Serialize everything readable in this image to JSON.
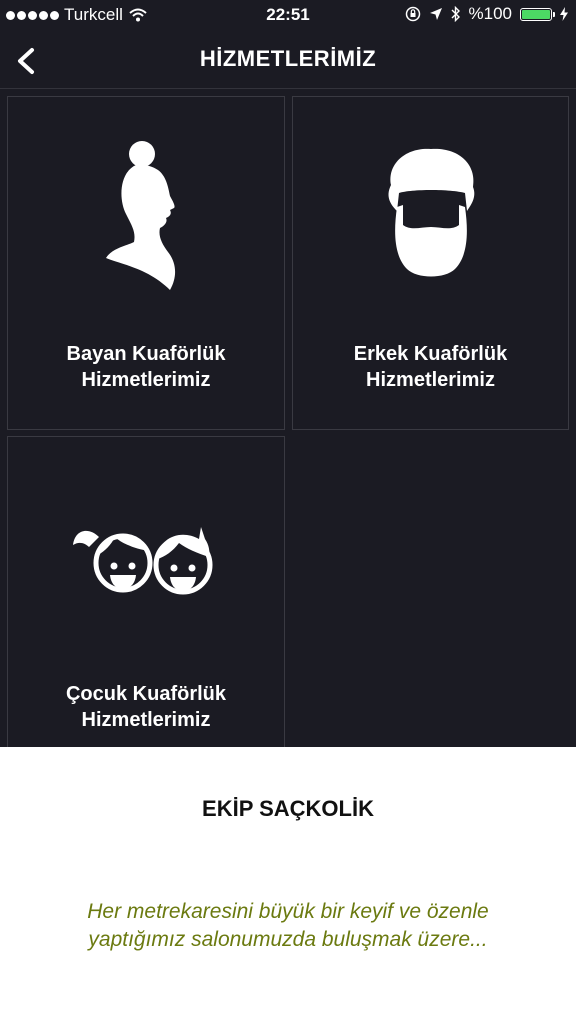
{
  "status_bar": {
    "carrier": "Turkcell",
    "time": "22:51",
    "battery_percent": "%100",
    "battery_level": 1.0
  },
  "nav": {
    "title": "HİZMETLERİMİZ",
    "back_icon": "chevron-left-icon"
  },
  "services": [
    {
      "line1": "Bayan Kuaförlük",
      "line2": "Hizmetlerimiz",
      "icon": "woman-silhouette-icon"
    },
    {
      "line1": "Erkek Kuaförlük",
      "line2": "Hizmetlerimiz",
      "icon": "bearded-man-icon"
    },
    {
      "line1": "Çocuk Kuaförlük",
      "line2": "Hizmetlerimiz",
      "icon": "children-faces-icon"
    }
  ],
  "footer": {
    "title": "EKİP SAÇKOLİK",
    "line1": "Her metrekaresini büyük bir keyif ve özenle",
    "line2": "yaptığımız salonumuzda buluşmak üzere..."
  },
  "colors": {
    "background": "#1b1b23",
    "tile_border": "#3a3a42",
    "footer_text": "#6b7a10",
    "battery": "#4cd964"
  }
}
